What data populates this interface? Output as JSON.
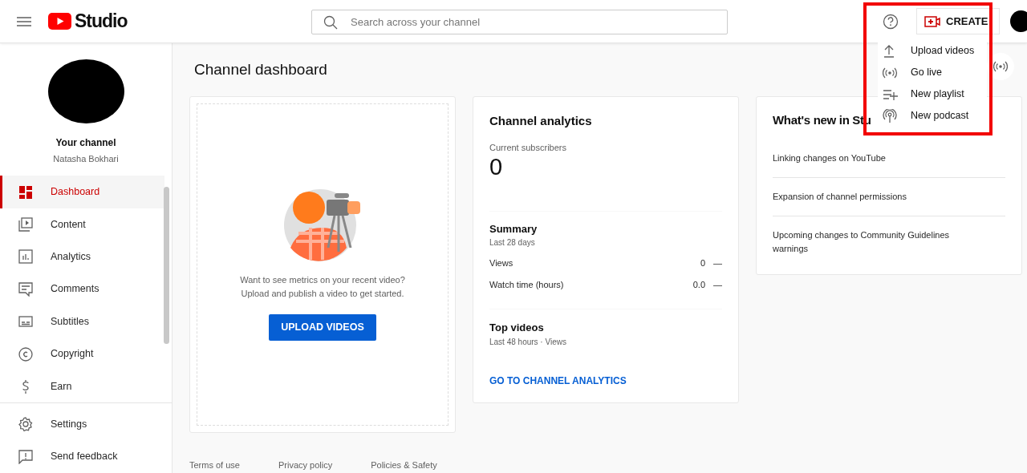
{
  "header": {
    "logo_text": "Studio",
    "search": {
      "placeholder": "Search across your channel"
    },
    "create_button": "CREATE"
  },
  "create_menu": [
    {
      "label": "Upload videos"
    },
    {
      "label": "Go live"
    },
    {
      "label": "New playlist"
    },
    {
      "label": "New podcast"
    }
  ],
  "sidebar": {
    "channel_title": "Your channel",
    "channel_name": "Natasha Bokhari",
    "items": [
      {
        "label": "Dashboard",
        "selected": true
      },
      {
        "label": "Content",
        "selected": false
      },
      {
        "label": "Analytics",
        "selected": false
      },
      {
        "label": "Comments",
        "selected": false
      },
      {
        "label": "Subtitles",
        "selected": false
      },
      {
        "label": "Copyright",
        "selected": false
      },
      {
        "label": "Earn",
        "selected": false
      }
    ],
    "bottom_items": [
      {
        "label": "Settings"
      },
      {
        "label": "Send feedback"
      }
    ]
  },
  "page_title": "Channel dashboard",
  "upload_card": {
    "message": "Want to see metrics on your recent video? Upload and publish a video to get started.",
    "button": "UPLOAD VIDEOS"
  },
  "analytics_card": {
    "title": "Channel analytics",
    "subscribers_label": "Current subscribers",
    "subscribers": "0",
    "summary_title": "Summary",
    "summary_period": "Last 28 days",
    "metrics": [
      {
        "label": "Views",
        "value": "0",
        "trend": "—"
      },
      {
        "label": "Watch time (hours)",
        "value": "0.0",
        "trend": "—"
      }
    ],
    "top_title": "Top videos",
    "top_period": "Last 48 hours · Views",
    "link": "GO TO CHANNEL ANALYTICS"
  },
  "news_card": {
    "title": "What's new in Stu",
    "items": [
      "Linking changes on YouTube",
      "Expansion of channel permissions",
      "Upcoming changes to Community Guidelines warnings"
    ]
  },
  "footer": [
    "Terms of use",
    "Privacy policy",
    "Policies & Safety"
  ]
}
